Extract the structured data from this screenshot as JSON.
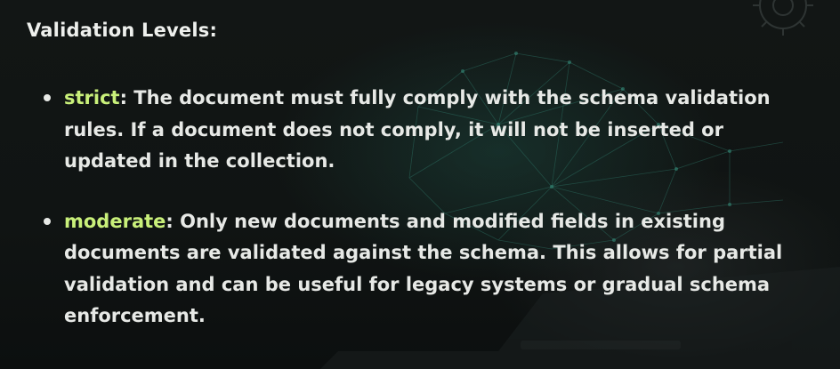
{
  "heading": "Validation Levels:",
  "levels": [
    {
      "term": "strict",
      "separator": ":",
      "description": " The document must fully comply with the schema validation rules. If a document does not comply, it will not be inserted or updated in the collection."
    },
    {
      "term": "moderate",
      "separator": ":",
      "description": " Only new documents and modified fields in existing documents are validated against the schema. This allows for partial validation and can be useful for legacy systems or gradual schema enforcement."
    }
  ],
  "colors": {
    "background": "#0f1312",
    "text": "#e7e9e6",
    "term_highlight": "#c9f07a",
    "wireframe_accent": "#2f7a6b"
  },
  "icons": {
    "top_right": "gear-icon",
    "background": "wireframe-hand-laptop"
  }
}
